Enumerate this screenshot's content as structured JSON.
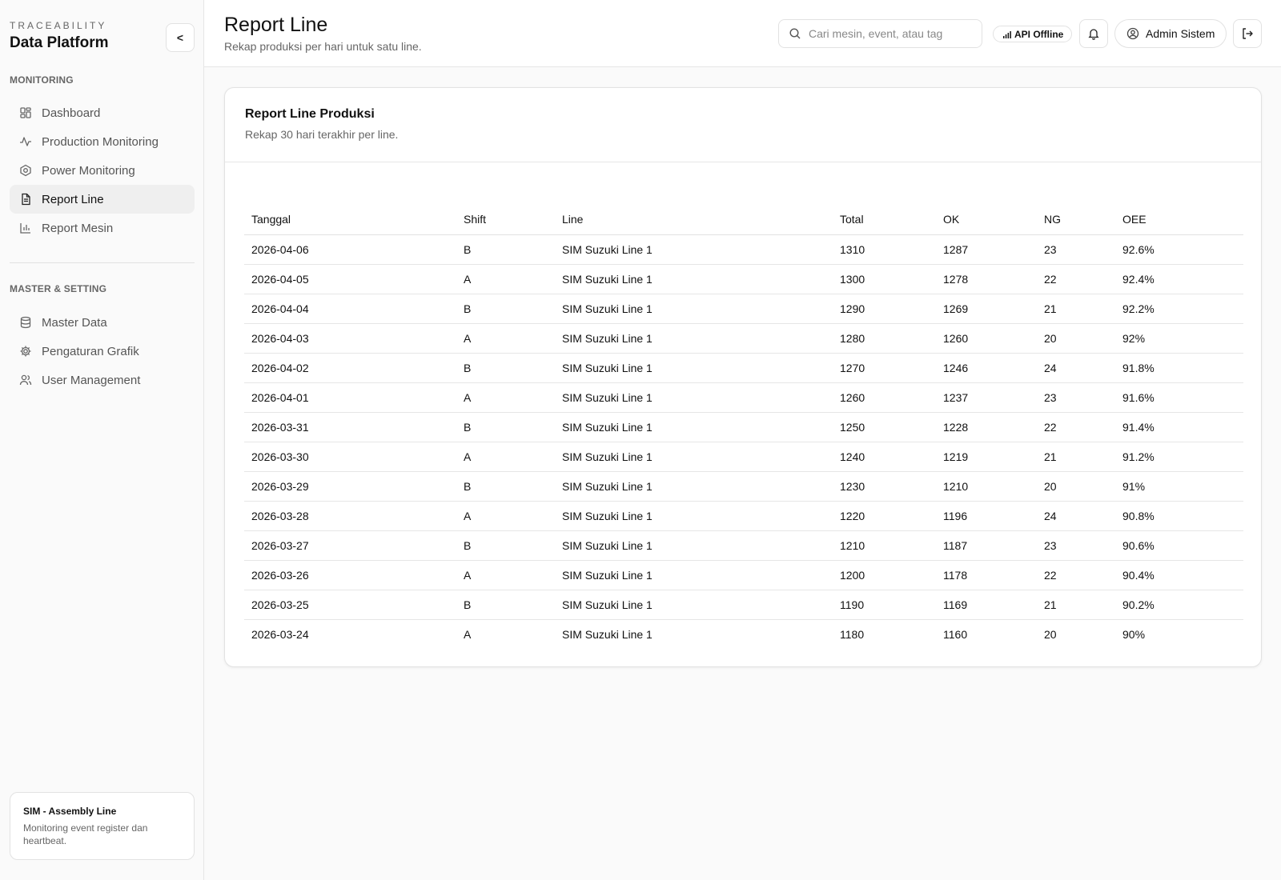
{
  "brand": {
    "kicker": "TRACEABILITY",
    "title": "Data Platform",
    "collapse_label": "<"
  },
  "sidebar": {
    "sections": [
      {
        "label": "MONITORING"
      },
      {
        "label": "MASTER & SETTING"
      }
    ],
    "items": [
      {
        "label": "Dashboard",
        "icon": "dashboard-icon"
      },
      {
        "label": "Production Monitoring",
        "icon": "activity-icon"
      },
      {
        "label": "Power Monitoring",
        "icon": "power-icon"
      },
      {
        "label": "Report Line",
        "icon": "file-text-icon",
        "active": true
      },
      {
        "label": "Report Mesin",
        "icon": "bar-chart-icon"
      },
      {
        "label": "Master Data",
        "icon": "database-icon"
      },
      {
        "label": "Pengaturan Grafik",
        "icon": "gear-icon"
      },
      {
        "label": "User Management",
        "icon": "users-icon"
      }
    ],
    "footer": {
      "title": "SIM - Assembly Line",
      "desc": "Monitoring event register dan heartbeat."
    }
  },
  "header": {
    "title": "Report Line",
    "subtitle": "Rekap produksi per hari untuk satu line.",
    "search_placeholder": "Cari mesin, event, atau tag",
    "api_status": "API Offline",
    "user_name": "Admin Sistem"
  },
  "card": {
    "title": "Report Line Produksi",
    "desc": "Rekap 30 hari terakhir per line.",
    "columns": [
      "Tanggal",
      "Shift",
      "Line",
      "Total",
      "OK",
      "NG",
      "OEE"
    ],
    "rows": [
      [
        "2026-04-06",
        "B",
        "SIM Suzuki Line 1",
        "1310",
        "1287",
        "23",
        "92.6%"
      ],
      [
        "2026-04-05",
        "A",
        "SIM Suzuki Line 1",
        "1300",
        "1278",
        "22",
        "92.4%"
      ],
      [
        "2026-04-04",
        "B",
        "SIM Suzuki Line 1",
        "1290",
        "1269",
        "21",
        "92.2%"
      ],
      [
        "2026-04-03",
        "A",
        "SIM Suzuki Line 1",
        "1280",
        "1260",
        "20",
        "92%"
      ],
      [
        "2026-04-02",
        "B",
        "SIM Suzuki Line 1",
        "1270",
        "1246",
        "24",
        "91.8%"
      ],
      [
        "2026-04-01",
        "A",
        "SIM Suzuki Line 1",
        "1260",
        "1237",
        "23",
        "91.6%"
      ],
      [
        "2026-03-31",
        "B",
        "SIM Suzuki Line 1",
        "1250",
        "1228",
        "22",
        "91.4%"
      ],
      [
        "2026-03-30",
        "A",
        "SIM Suzuki Line 1",
        "1240",
        "1219",
        "21",
        "91.2%"
      ],
      [
        "2026-03-29",
        "B",
        "SIM Suzuki Line 1",
        "1230",
        "1210",
        "20",
        "91%"
      ],
      [
        "2026-03-28",
        "A",
        "SIM Suzuki Line 1",
        "1220",
        "1196",
        "24",
        "90.8%"
      ],
      [
        "2026-03-27",
        "B",
        "SIM Suzuki Line 1",
        "1210",
        "1187",
        "23",
        "90.6%"
      ],
      [
        "2026-03-26",
        "A",
        "SIM Suzuki Line 1",
        "1200",
        "1178",
        "22",
        "90.4%"
      ],
      [
        "2026-03-25",
        "B",
        "SIM Suzuki Line 1",
        "1190",
        "1169",
        "21",
        "90.2%"
      ],
      [
        "2026-03-24",
        "A",
        "SIM Suzuki Line 1",
        "1180",
        "1160",
        "20",
        "90%"
      ]
    ]
  }
}
